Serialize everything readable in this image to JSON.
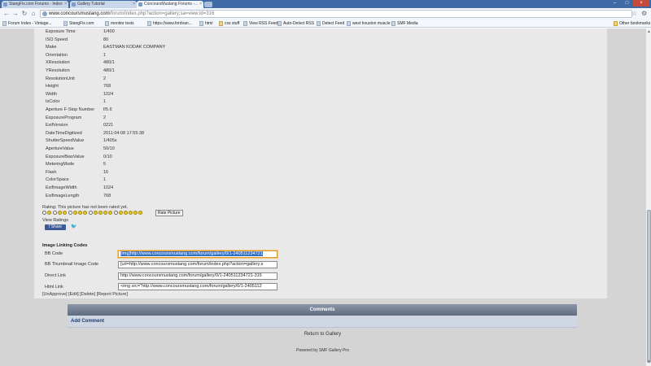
{
  "browser": {
    "tabs": [
      {
        "label": "StangFix.com Forums - Index"
      },
      {
        "label": "Gallery Tutorial"
      },
      {
        "label": "ConcoursMustang Forums -..."
      }
    ],
    "url": {
      "host": "www.concoursmustang.com",
      "path": "/forum/index.php?action=gallery;sa=view;id=316"
    },
    "bookmarks": [
      "Forum Index - Vintage...",
      "StangFix.com",
      "monitor tests",
      "https://www.fordvan...",
      "html",
      "css stuff",
      "View RSS Feed",
      "Auto-Detect RSS",
      "Detect Feed",
      "west houston muscle",
      "SMF Media"
    ],
    "other_bookmarks": "Other bookmarks"
  },
  "exif": [
    {
      "key": "Exposure Time",
      "value": "1/400"
    },
    {
      "key": "ISO Speed",
      "value": "80"
    },
    {
      "key": "Make",
      "value": "EASTMAN KODAK COMPANY"
    },
    {
      "key": "Orientation",
      "value": "1"
    },
    {
      "key": "XResolution",
      "value": "480/1"
    },
    {
      "key": "YResolution",
      "value": "480/1"
    },
    {
      "key": "ResolutionUnit",
      "value": "2"
    },
    {
      "key": "Height",
      "value": "768"
    },
    {
      "key": "Width",
      "value": "1024"
    },
    {
      "key": "IsColor",
      "value": "1"
    },
    {
      "key": "Aperture F-Stop Number",
      "value": "f/5.6"
    },
    {
      "key": "ExposureProgram",
      "value": "2"
    },
    {
      "key": "ExifVersion",
      "value": "0221"
    },
    {
      "key": "DateTimeDigitized",
      "value": "2011:04:08 17:55:38"
    },
    {
      "key": "ShutterSpeedValue",
      "value": "1/405s"
    },
    {
      "key": "ApertureValue",
      "value": "50/10"
    },
    {
      "key": "ExposureBiasValue",
      "value": "0/10"
    },
    {
      "key": "MeteringMode",
      "value": "5"
    },
    {
      "key": "Flash",
      "value": "16"
    },
    {
      "key": "ColorSpace",
      "value": "1"
    },
    {
      "key": "ExifImageWidth",
      "value": "1024"
    },
    {
      "key": "ExifImageLength",
      "value": "768"
    }
  ],
  "rating": {
    "text": "Rating: This picture has not been rated yet.",
    "button": "Rate Picture",
    "view_ratings": "View Ratings"
  },
  "social": {
    "share": "Share"
  },
  "image_linking": {
    "title": "Image Linking Codes",
    "rows": [
      {
        "label": "BB Code",
        "value": "[img]http://www.concoursmustang.com/forum/gallery/0/1-240511234721"
      },
      {
        "label": "BB Thumbnail Image Code",
        "value": "[url=http://www.concoursmustang.com/forum/index.php?action=gallery;s"
      },
      {
        "label": "Direct Link",
        "value": "http://www.concoursmustang.com/forum/gallery/0/1-240511234721-315"
      },
      {
        "label": "Html Link",
        "value": "<img src=\"http://www.concoursmustang.com/forum/gallery/0/1-2405112"
      }
    ]
  },
  "actions": {
    "unapprove": "[UnApprove]",
    "edit": "[Edit]",
    "delete": "[Delete]",
    "report": "[Report Picture]"
  },
  "comments": {
    "header": "Comments",
    "add": "Add Comment",
    "return": "Return to Gallery"
  },
  "footer": {
    "powered": "Powered by SMF Gallery Pro"
  },
  "colors": {
    "comments_header": "#5f6b80",
    "share": "#3b5998",
    "selection": "#3471c5"
  }
}
